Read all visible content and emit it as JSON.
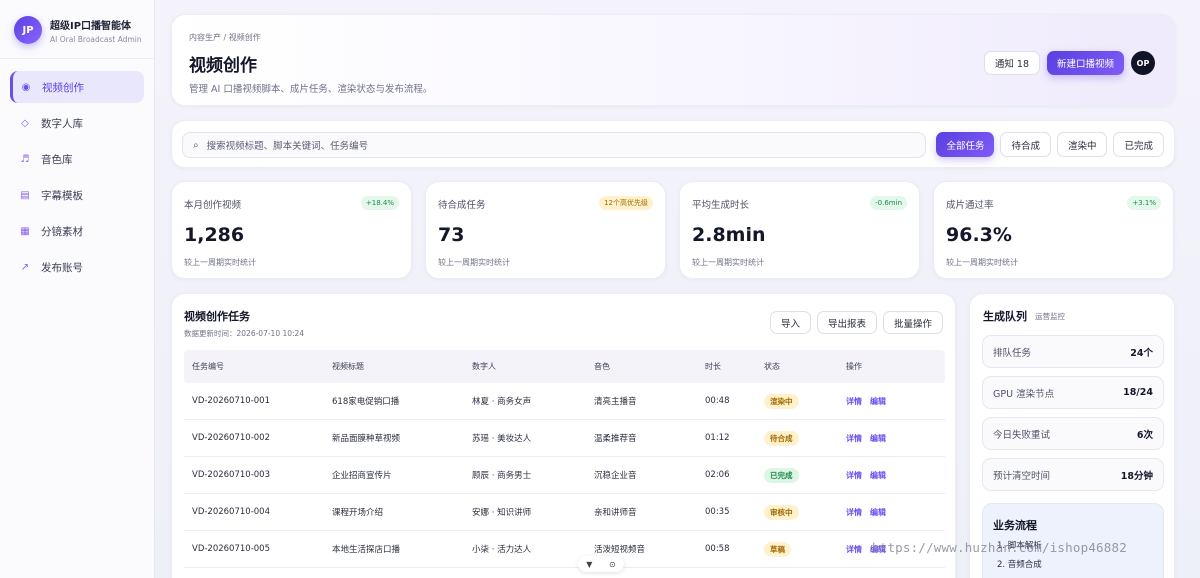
{
  "brand": {
    "logo": "JP",
    "title": "超级IP口播智能体",
    "subtitle": "AI Oral Broadcast Admin"
  },
  "sidebar": {
    "items": [
      {
        "icon": "radio-dot-icon",
        "glyph": "◉",
        "label": "视频创作",
        "active": true
      },
      {
        "icon": "diamond-icon",
        "glyph": "◇",
        "label": "数字人库"
      },
      {
        "icon": "music-note-icon",
        "glyph": "♬",
        "label": "音色库"
      },
      {
        "icon": "subtitle-template-icon",
        "glyph": "▤",
        "label": "字幕模板"
      },
      {
        "icon": "storyboard-icon",
        "glyph": "▦",
        "label": "分镜素材"
      },
      {
        "icon": "publish-arrow-icon",
        "glyph": "↗",
        "label": "发布账号"
      }
    ]
  },
  "header": {
    "breadcrumb": "内容生产 / 视频创作",
    "title": "视频创作",
    "description": "管理 AI 口播视频脚本、成片任务、渲染状态与发布流程。",
    "notify_label": "通知 18",
    "new_label": "新建口播视频",
    "avatar": "OP"
  },
  "search": {
    "placeholder": "搜索视频标题、脚本关键词、任务编号",
    "filters": [
      "全部任务",
      "待合成",
      "渲染中",
      "已完成"
    ],
    "active_filter": 0
  },
  "stats": [
    {
      "label": "本月创作视频",
      "badge": "+18.4%",
      "badge_type": "green",
      "value": "1,286",
      "sub": "较上一周期实时统计"
    },
    {
      "label": "待合成任务",
      "badge": "12个高优先级",
      "badge_type": "amber",
      "value": "73",
      "sub": "较上一周期实时统计"
    },
    {
      "label": "平均生成时长",
      "badge": "-0.6min",
      "badge_type": "green",
      "value": "2.8min",
      "sub": "较上一周期实时统计"
    },
    {
      "label": "成片通过率",
      "badge": "+3.1%",
      "badge_type": "green",
      "value": "96.3%",
      "sub": "较上一周期实时统计"
    }
  ],
  "table": {
    "title": "视频创作任务",
    "updated": "数据更新时间：2026-07-10 10:24",
    "actions": [
      "导入",
      "导出报表",
      "批量操作"
    ],
    "columns": [
      "任务编号",
      "视频标题",
      "数字人",
      "音色",
      "时长",
      "状态",
      "操作"
    ],
    "rows": [
      {
        "id": "VD-20260710-001",
        "title": "618家电促销口播",
        "avatar": "林夏 · 商务女声",
        "voice": "清亮主播音",
        "duration": "00:48",
        "status": "渲染中",
        "status_bg": "#fff1cc",
        "status_fg": "#a06a00"
      },
      {
        "id": "VD-20260710-002",
        "title": "新品面膜种草视频",
        "avatar": "苏瑶 · 美妆达人",
        "voice": "温柔推荐音",
        "duration": "01:12",
        "status": "待合成",
        "status_bg": "#fff1cc",
        "status_fg": "#a06a00"
      },
      {
        "id": "VD-20260710-003",
        "title": "企业招商宣传片",
        "avatar": "顾辰 · 商务男士",
        "voice": "沉稳企业音",
        "duration": "02:06",
        "status": "已完成",
        "status_bg": "#dcf5e5",
        "status_fg": "#1f8a4c"
      },
      {
        "id": "VD-20260710-004",
        "title": "课程开场介绍",
        "avatar": "安娜 · 知识讲师",
        "voice": "亲和讲师音",
        "duration": "00:35",
        "status": "审核中",
        "status_bg": "#fff1cc",
        "status_fg": "#a06a00"
      },
      {
        "id": "VD-20260710-005",
        "title": "本地生活探店口播",
        "avatar": "小柒 · 活力达人",
        "voice": "活泼短视频音",
        "duration": "00:58",
        "status": "草稿",
        "status_bg": "#fff1cc",
        "status_fg": "#a06a00"
      }
    ],
    "detail_label": "详情",
    "edit_label": "编辑"
  },
  "queue": {
    "title": "生成队列",
    "tag": "运营监控",
    "items": [
      {
        "label": "排队任务",
        "value": "24个"
      },
      {
        "label": "GPU 渲染节点",
        "value": "18/24"
      },
      {
        "label": "今日失败重试",
        "value": "6次"
      },
      {
        "label": "预计清空时间",
        "value": "18分钟"
      }
    ],
    "flow_title": "业务流程",
    "flow_items": [
      "1. 脚本解析",
      "2. 音频合成"
    ]
  },
  "float": {
    "down": "▼",
    "circle": "⊙"
  },
  "watermark": "https://www.huzhan.com/ishop46882",
  "colors": {
    "accent": "#6b4ef0",
    "brand_dark": "#5b3fe0"
  }
}
